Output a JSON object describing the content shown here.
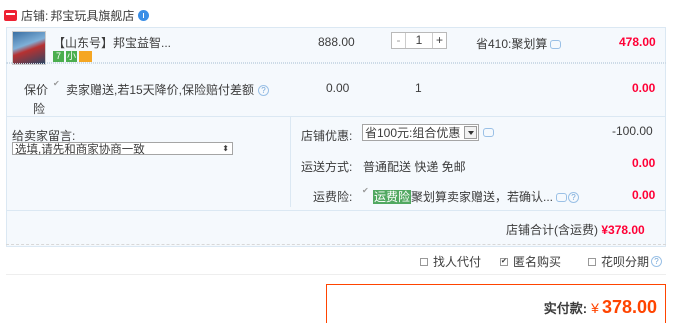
{
  "shop": {
    "label": "店铺:",
    "name": "邦宝玩具旗舰店"
  },
  "item": {
    "title": "【山东号】邦宝益智...",
    "price": "888.00",
    "quantity": "1",
    "minus": "-",
    "plus": "+",
    "discount": "省410:聚划算",
    "subtotal": "478.00",
    "badges": [
      "7",
      "小"
    ]
  },
  "insurance": {
    "label_line1": "保价",
    "label_line2": "险",
    "desc": "卖家赠送,若15天降价,保险赔付差额",
    "price": "0.00",
    "quantity": "1",
    "subtotal": "0.00"
  },
  "message": {
    "label": "给卖家留言:",
    "value": "选填,请先和商家协商一致"
  },
  "shop_discount": {
    "label": "店铺优惠:",
    "option": "省100元:组合优惠",
    "amount": "-100.00"
  },
  "shipping": {
    "label": "运送方式:",
    "value": "普通配送 快递 免邮",
    "amount": "0.00"
  },
  "shipping_insurance": {
    "label": "运费险:",
    "tag": "运费险",
    "desc": "聚划算卖家赠送，若确认...",
    "amount": "0.00"
  },
  "shop_total": {
    "label": "店铺合计(含运费)",
    "amount": "¥378.00"
  },
  "options": {
    "proxy_pay": "找人代付",
    "anonymous": "匿名购买",
    "huabei": "花呗分期"
  },
  "footer": {
    "label": "实付款:",
    "currency": "¥",
    "amount": "378.00"
  },
  "colors": {
    "accent": "#ff0036",
    "panel": "#f5f9fd",
    "border": "#dbe8f3"
  }
}
